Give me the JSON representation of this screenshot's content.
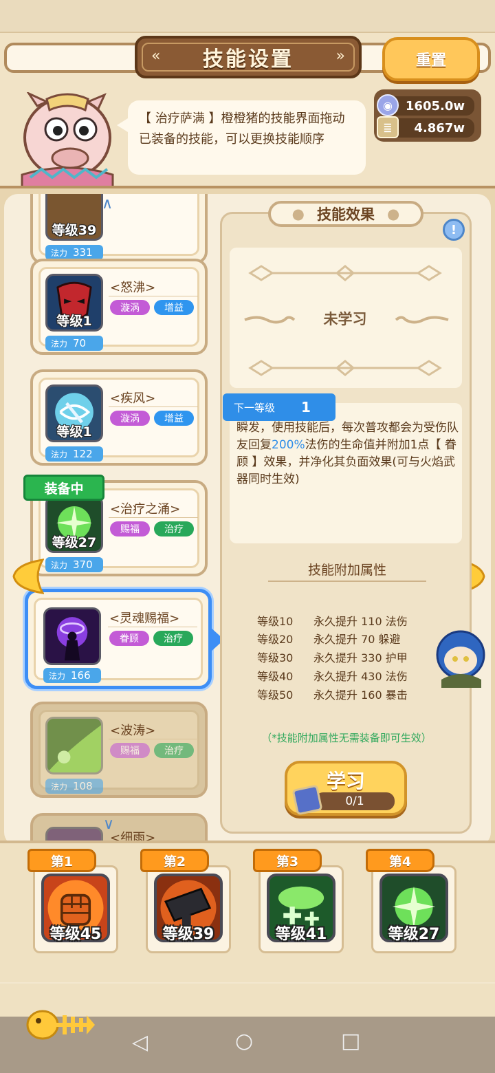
{
  "header": {
    "title": "技能设置",
    "reset_label": "重置"
  },
  "npc": {
    "dialog": "【 治疗萨满 】橙橙猪的技能界面拖动已装备的技能，可以更换技能顺序"
  },
  "currency": [
    {
      "icon": "silver-coin-icon",
      "value": "1605.0w"
    },
    {
      "icon": "scroll-icon",
      "value": "4.867w"
    }
  ],
  "skill_list": {
    "mana_label": "法力",
    "equipped_badge": "装备中",
    "items": [
      {
        "name": "",
        "level": "等级39",
        "tags": [
          "",
          ""
        ],
        "mana": "331"
      },
      {
        "name": "<怒沸>",
        "level": "等级1",
        "tags": [
          "漩涡",
          "增益"
        ],
        "mana": "70"
      },
      {
        "name": "<疾风>",
        "level": "等级1",
        "tags": [
          "漩涡",
          "增益"
        ],
        "mana": "122"
      },
      {
        "name": "<治疗之涌>",
        "level": "等级27",
        "tags": [
          "赐福",
          "治疗"
        ],
        "mana": "370"
      },
      {
        "name": "<灵魂赐福>",
        "level": "",
        "tags": [
          "眷顾",
          "治疗"
        ],
        "mana": "166"
      },
      {
        "name": "<波涛>",
        "level": "",
        "tags": [
          "赐福",
          "治疗"
        ],
        "mana": "108"
      },
      {
        "name": "<细雨>",
        "level": "",
        "tags": [
          "",
          ""
        ],
        "mana": ""
      }
    ]
  },
  "effect": {
    "title": "技能效果",
    "status": "未学习",
    "next_level_label": "下一等级",
    "next_level_value": "1",
    "desc_1": "瞬发，使用技能后，每次普攻都会为受伤队友回复",
    "desc_hl": "200%",
    "desc_2": "法伤的生命值并附加1点【 眷顾 】效果，并净化其负面效果(可与火焰武器同时生效)",
    "attr_title": "技能附加属性",
    "attrs": [
      {
        "level": "等级10",
        "bonus": "永久提升 110 法伤"
      },
      {
        "level": "等级20",
        "bonus": "永久提升 70 躲避"
      },
      {
        "level": "等级30",
        "bonus": "永久提升 330 护甲"
      },
      {
        "level": "等级40",
        "bonus": "永久提升 430 法伤"
      },
      {
        "level": "等级50",
        "bonus": "永久提升 160 暴击"
      }
    ],
    "note": "（*技能附加属性无需装备即可生效）",
    "learn_label": "学习",
    "learn_progress": "0/1"
  },
  "equipped_slots": [
    {
      "label": "第1",
      "level": "等级45",
      "icon": "fist-icon"
    },
    {
      "label": "第2",
      "level": "等级39",
      "icon": "hammer-icon"
    },
    {
      "label": "第3",
      "level": "等级41",
      "icon": "heal-cloud-icon"
    },
    {
      "label": "第4",
      "level": "等级27",
      "icon": "healing-surge-icon"
    }
  ],
  "colors": {
    "accent_blue": "#2f8ee8",
    "equipped_green": "#2bb54f",
    "slot_orange": "#ff9a1e"
  }
}
